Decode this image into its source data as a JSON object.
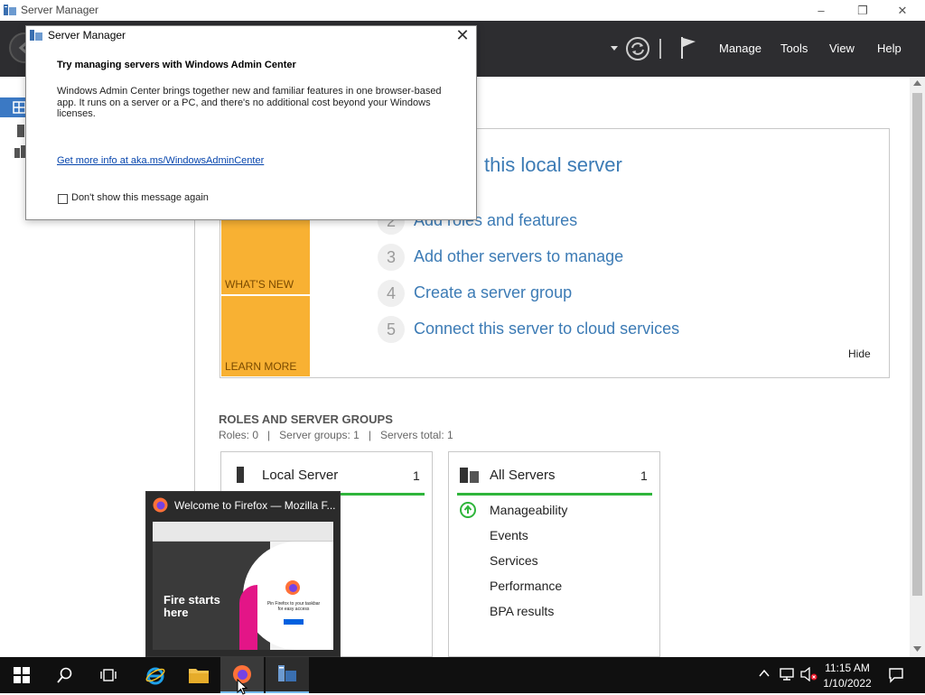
{
  "window": {
    "title": "Server Manager",
    "minimize_glyph": "–",
    "restore_glyph": "❐",
    "close_glyph": "✕"
  },
  "toolbar": {
    "menus": [
      "Manage",
      "Tools",
      "View",
      "Help"
    ]
  },
  "welcome": {
    "heading_fragment": "this local server",
    "steps": [
      {
        "num": "2",
        "label": "Add roles and features"
      },
      {
        "num": "3",
        "label": "Add other servers to manage"
      },
      {
        "num": "4",
        "label": "Create a server group"
      },
      {
        "num": "5",
        "label": "Connect this server to cloud services"
      }
    ],
    "tiles": {
      "whats_new": "WHAT'S NEW",
      "learn_more": "LEARN MORE"
    },
    "hide_label": "Hide"
  },
  "roles": {
    "heading": "ROLES AND SERVER GROUPS",
    "summary": "Roles: 0   |   Server groups: 1   |   Servers total: 1",
    "local_server": {
      "title": "Local Server",
      "count": "1"
    },
    "all_servers": {
      "title": "All Servers",
      "count": "1",
      "items": [
        "Manageability",
        "Events",
        "Services",
        "Performance",
        "BPA results"
      ]
    }
  },
  "dialog": {
    "title": "Server Manager",
    "close_glyph": "✕",
    "heading": "Try managing servers with Windows Admin Center",
    "body": "Windows Admin Center brings together new and familiar features in one browser-based app. It runs on a server or a PC, and there's no additional cost beyond your Windows licenses.",
    "link": "Get more info at aka.ms/WindowsAdminCenter",
    "checkbox_label": "Don't show this message again"
  },
  "firefox_preview": {
    "title": "Welcome to Firefox — Mozilla F...",
    "thumb_headline": "Fire starts here",
    "thumb_caption": "Pin Firefox to your taskbar for easy access"
  },
  "taskbar": {
    "time": "11:15 AM",
    "date": "1/10/2022"
  },
  "colors": {
    "toolbar_bg": "#2d2d30",
    "tile_orange": "#f8b133",
    "link_blue": "#3c7bb5",
    "status_green": "#2fb53b",
    "taskbar_bg": "#101010"
  }
}
